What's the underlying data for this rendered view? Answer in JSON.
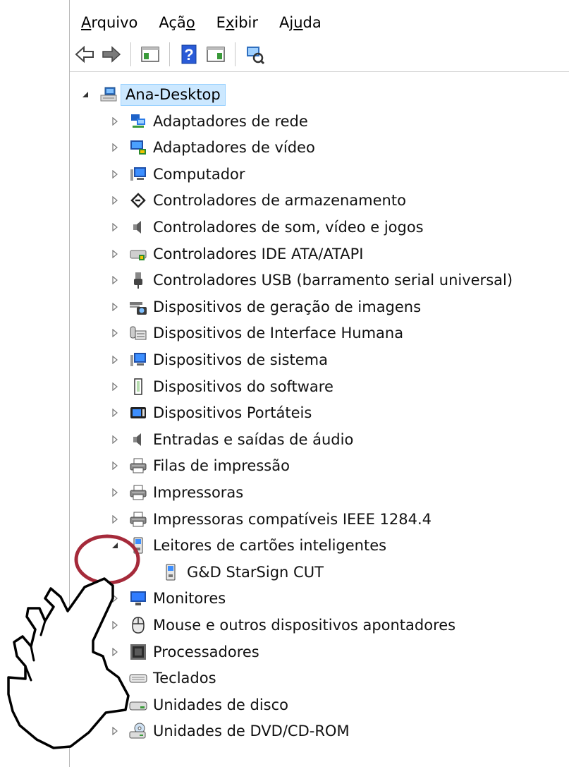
{
  "menu": [
    {
      "id": "arquivo",
      "pre": "",
      "ul": "A",
      "post": "rquivo"
    },
    {
      "id": "acao",
      "pre": "Açã",
      "ul": "o",
      "post": ""
    },
    {
      "id": "exibir",
      "pre": "E",
      "ul": "x",
      "post": "ibir"
    },
    {
      "id": "ajuda",
      "pre": "Aj",
      "ul": "u",
      "post": "da"
    }
  ],
  "toolbar": [
    {
      "name": "back-button-icon"
    },
    {
      "name": "forward-button-icon"
    },
    {
      "name": "separator"
    },
    {
      "name": "show-hide-console-tree-icon"
    },
    {
      "name": "separator"
    },
    {
      "name": "help-icon"
    },
    {
      "name": "show-hide-action-pane-icon"
    },
    {
      "name": "separator"
    },
    {
      "name": "scan-hardware-changes-icon"
    }
  ],
  "tree": {
    "root": {
      "label": "Ana-Desktop",
      "expanded": true,
      "selected": true,
      "icon": "computer-icon"
    },
    "items": [
      {
        "label": "Adaptadores de rede",
        "icon": "network-adapter-icon",
        "expanded": false
      },
      {
        "label": "Adaptadores de vídeo",
        "icon": "display-adapter-icon",
        "expanded": false
      },
      {
        "label": "Computador",
        "icon": "computer-monitor-icon",
        "expanded": false
      },
      {
        "label": "Controladores de armazenamento",
        "icon": "storage-controller-icon",
        "expanded": false
      },
      {
        "label": "Controladores de som, vídeo e jogos",
        "icon": "speaker-icon",
        "expanded": false
      },
      {
        "label": "Controladores IDE ATA/ATAPI",
        "icon": "ide-controller-icon",
        "expanded": false
      },
      {
        "label": "Controladores USB (barramento serial universal)",
        "icon": "usb-icon",
        "expanded": false
      },
      {
        "label": "Dispositivos de geração de imagens",
        "icon": "camera-icon",
        "expanded": false
      },
      {
        "label": "Dispositivos de Interface Humana",
        "icon": "hid-icon",
        "expanded": false
      },
      {
        "label": "Dispositivos de sistema",
        "icon": "system-device-icon",
        "expanded": false
      },
      {
        "label": "Dispositivos do software",
        "icon": "software-device-icon",
        "expanded": false
      },
      {
        "label": "Dispositivos Portáteis",
        "icon": "portable-device-icon",
        "expanded": false
      },
      {
        "label": "Entradas e saídas de áudio",
        "icon": "audio-io-icon",
        "expanded": false
      },
      {
        "label": "Filas de impressão",
        "icon": "print-queue-icon",
        "expanded": false
      },
      {
        "label": "Impressoras",
        "icon": "printer-icon",
        "expanded": false
      },
      {
        "label": "Impressoras compatíveis IEEE 1284.4",
        "icon": "printer-ieee-icon",
        "expanded": false
      },
      {
        "label": "Leitores de cartões inteligentes",
        "icon": "smart-card-reader-icon",
        "expanded": true,
        "children": [
          {
            "label": "G&D StarSign CUT",
            "icon": "smart-card-device-icon"
          }
        ]
      },
      {
        "label": "Monitores",
        "icon": "monitor-icon",
        "expanded": false
      },
      {
        "label": "Mouse e outros dispositivos apontadores",
        "icon": "mouse-icon",
        "expanded": false
      },
      {
        "label": "Processadores",
        "icon": "processor-icon",
        "expanded": false
      },
      {
        "label": "Teclados",
        "icon": "keyboard-icon",
        "expanded": false
      },
      {
        "label": "Unidades de disco",
        "icon": "disk-drive-icon",
        "expanded": false
      },
      {
        "label": "Unidades de DVD/CD-ROM",
        "icon": "dvd-drive-icon",
        "expanded": false
      }
    ]
  },
  "annotation": {
    "highlight_color": "#a52a3a",
    "pointer": "hand-pointer-icon"
  }
}
